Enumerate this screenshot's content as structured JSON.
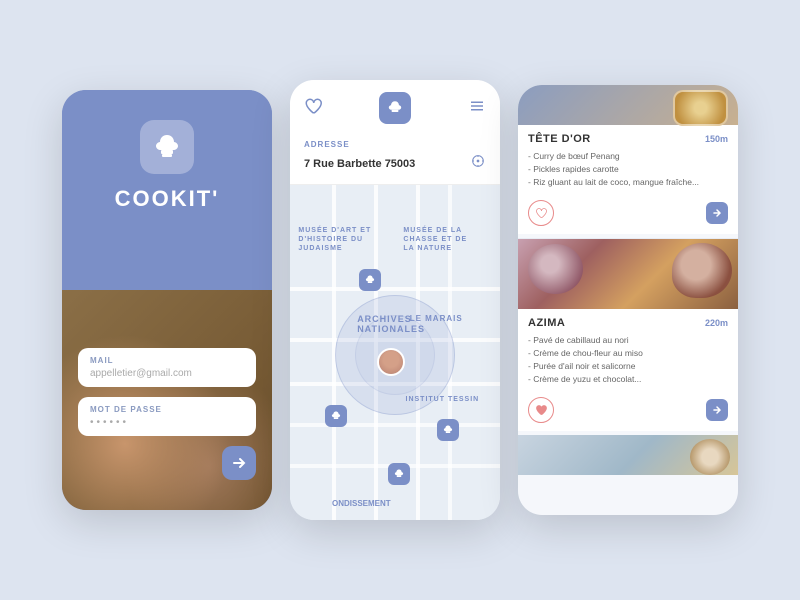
{
  "app": {
    "name": "COOKIT'",
    "background_color": "#dde4f0",
    "accent_color": "#7b8fc7"
  },
  "login_screen": {
    "title": "COOKIT'",
    "mail_label": "MAIL",
    "mail_placeholder": "appelletier@gmail.com",
    "password_label": "MOT DE PASSE",
    "password_dots": "••••••",
    "arrow_label": ">"
  },
  "map_screen": {
    "address_label": "ADRESSE",
    "address_value": "7 Rue Barbette 75003",
    "district_label": "LE MARAIS",
    "area_labels": [
      "Musée d'art et d'histoire du judaisme",
      "Musée de la Chasse et de la Nature",
      "Archives Nationales",
      "Institut Tessin"
    ],
    "street_label": "ONDISSEMENT"
  },
  "restaurants_screen": {
    "cards": [
      {
        "name": "TÊTE D'OR",
        "distance": "150m",
        "menu": [
          "- Curry de bœuf Penang",
          "- Pickles rapides carotte",
          "- Riz gluant au lait de coco, mangue fraîche..."
        ],
        "liked": false
      },
      {
        "name": "AZIMA",
        "distance": "220m",
        "menu": [
          "- Pavé de cabillaud au nori",
          "- Crème de chou-fleur au miso",
          "- Purée d'ail noir et salicorne",
          "- Crème de yuzu et chocolat..."
        ],
        "liked": true
      }
    ],
    "top_partial_label": ""
  }
}
